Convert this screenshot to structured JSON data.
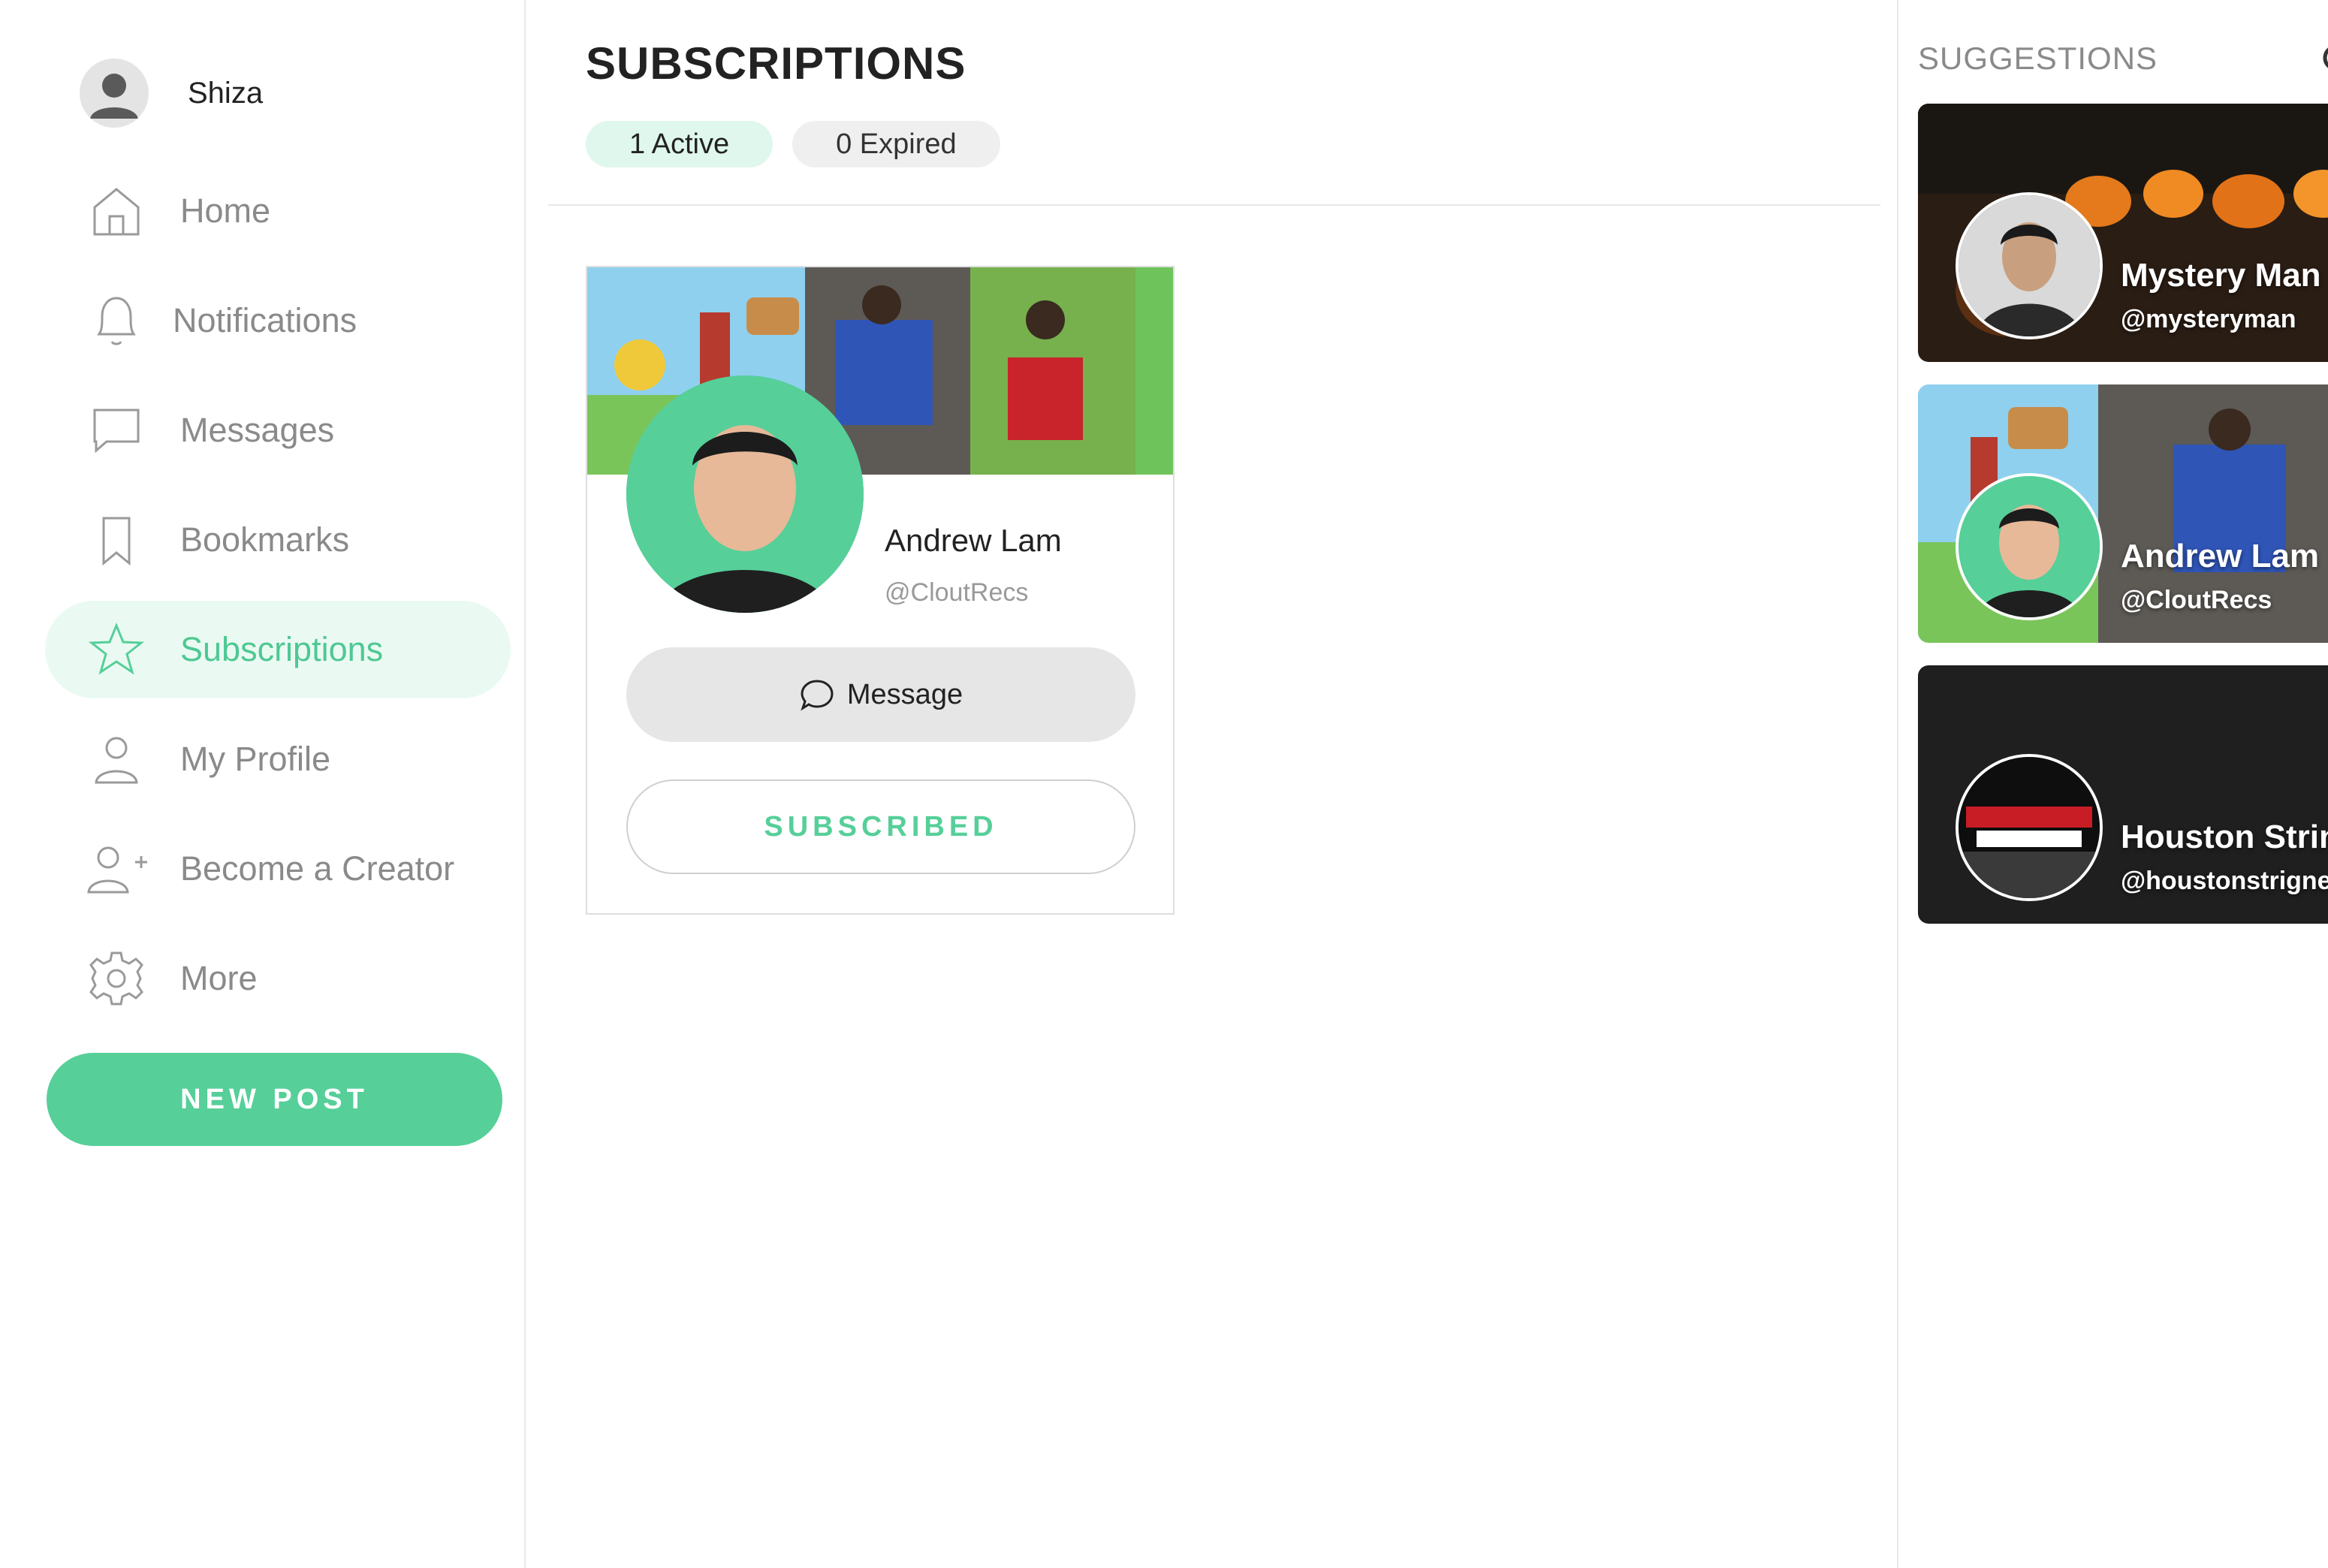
{
  "user": {
    "name": "Shiza",
    "avatar_icon": "person-silhouette-icon"
  },
  "sidebar": {
    "items": [
      {
        "label": "Home",
        "icon": "home-icon"
      },
      {
        "label": "Notifications",
        "icon": "bell-icon"
      },
      {
        "label": "Messages",
        "icon": "chat-bubble-icon"
      },
      {
        "label": "Bookmarks",
        "icon": "bookmark-icon"
      },
      {
        "label": "Subscriptions",
        "icon": "star-icon",
        "active": true
      },
      {
        "label": "My Profile",
        "icon": "user-icon"
      },
      {
        "label": "Become a Creator",
        "icon": "user-plus-icon"
      },
      {
        "label": "More",
        "icon": "gear-icon"
      }
    ],
    "new_post_label": "NEW POST"
  },
  "main": {
    "title": "SUBSCRIPTIONS",
    "tabs": [
      {
        "label": "1 Active",
        "active": true
      },
      {
        "label": "0 Expired",
        "active": false
      }
    ],
    "subscription_card": {
      "name": "Andrew Lam",
      "handle": "@CloutRecs",
      "message_label": "Message",
      "subscribed_label": "SUBSCRIBED"
    }
  },
  "suggestions": {
    "title": "SUGGESTIONS",
    "cards": [
      {
        "name": "Mystery Man",
        "handle": "@mysteryman"
      },
      {
        "name": "Andrew Lam",
        "handle": "@CloutRecs"
      },
      {
        "name": "Houston Strin",
        "handle": "@houstonstrigner"
      }
    ]
  },
  "colors": {
    "accent": "#56cf99",
    "accent_light": "#eafaf3",
    "muted_text": "#8a8a8a",
    "dark_card": "#1f1f1f"
  }
}
